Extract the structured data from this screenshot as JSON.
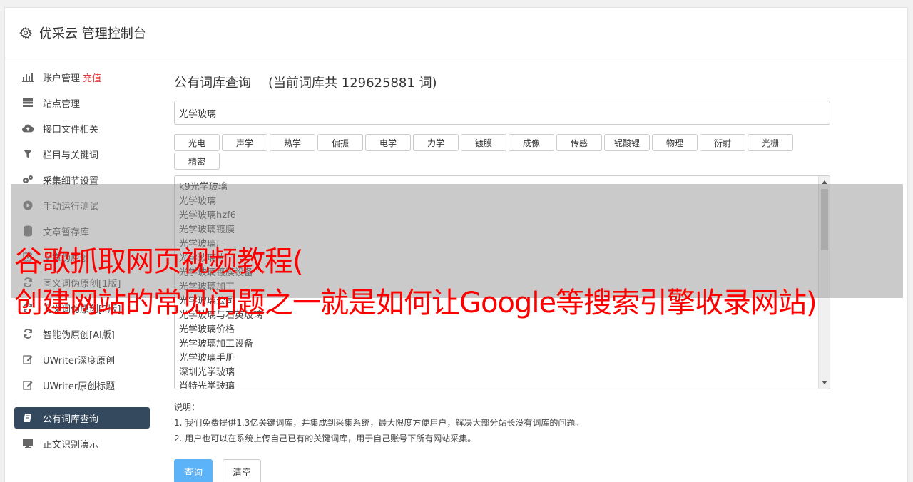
{
  "header": {
    "title": "优采云 管理控制台",
    "icon": "gear-icon"
  },
  "sidebar": {
    "items": [
      {
        "label": "账户管理",
        "badge": "充值",
        "icon": "bar-chart-icon"
      },
      {
        "label": "站点管理",
        "badge": "",
        "icon": "server-icon"
      },
      {
        "label": "接口文件相关",
        "badge": "",
        "icon": "cloud-upload-icon"
      },
      {
        "label": "栏目与关键词",
        "badge": "",
        "icon": "filter-icon"
      },
      {
        "label": "采集细节设置",
        "badge": "",
        "icon": "gears-icon"
      },
      {
        "label": "手动运行测试",
        "badge": "",
        "icon": "play-circle-icon"
      },
      {
        "label": "文章暂存库",
        "badge": "",
        "icon": "database-icon"
      },
      {
        "label": "文章伪原创",
        "badge": "",
        "icon": "edit-icon"
      },
      {
        "label": "同义词伪原创[1版]",
        "badge": "",
        "icon": "refresh-icon"
      },
      {
        "label": "同义词伪原创[2版]",
        "badge": "",
        "icon": "refresh-icon"
      },
      {
        "label": "智能伪原创[AI版]",
        "badge": "",
        "icon": "refresh-icon"
      },
      {
        "label": "UWriter深度原创",
        "badge": "",
        "icon": "edit-icon"
      },
      {
        "label": "UWriter原创标题",
        "badge": "",
        "icon": "edit-icon"
      }
    ],
    "active": {
      "label": "公有词库查询",
      "icon": "book-icon"
    },
    "after": [
      {
        "label": "正文识别演示",
        "icon": "desktop-icon"
      }
    ]
  },
  "main": {
    "title": "公有词库查询",
    "count_text": "(当前词库共 129625881 词)",
    "search_value": "光学玻璃",
    "tags": [
      "光电",
      "声学",
      "热学",
      "偏振",
      "电学",
      "力学",
      "镀膜",
      "成像",
      "传感",
      "铌酸锂",
      "物理",
      "衍射",
      "光栅",
      "精密"
    ],
    "results": [
      "k9光学玻璃",
      "光学玻璃",
      "光学玻璃hzf6",
      "光学玻璃镀膜",
      "光学玻璃厂",
      "光学玻璃片",
      "光学玻璃镀膜设备",
      "光学玻璃加工",
      "光学玻璃公司",
      "光学玻璃与石英玻璃",
      "光学玻璃价格",
      "光学玻璃加工设备",
      "光学玻璃手册",
      "深圳光学玻璃",
      "肖特光学玻璃"
    ],
    "notes_title": "说明：",
    "notes": [
      "1. 我们免费提供1.3亿关键词库，并集成到采集系统，最大限度方便用户，解决大部分站长没有词库的问题。",
      "2. 用户也可以在系统上传自己已有的关键词库，用于自己账号下所有网站采集。"
    ],
    "query_button": "查询",
    "clear_button": "清空"
  },
  "watermark": {
    "line1": "谷歌抓取网页视频教程(",
    "line2": "创建网站的常见问题之一就是如何让Google等搜索引擎收录网站)",
    "color": "#ff0000"
  }
}
